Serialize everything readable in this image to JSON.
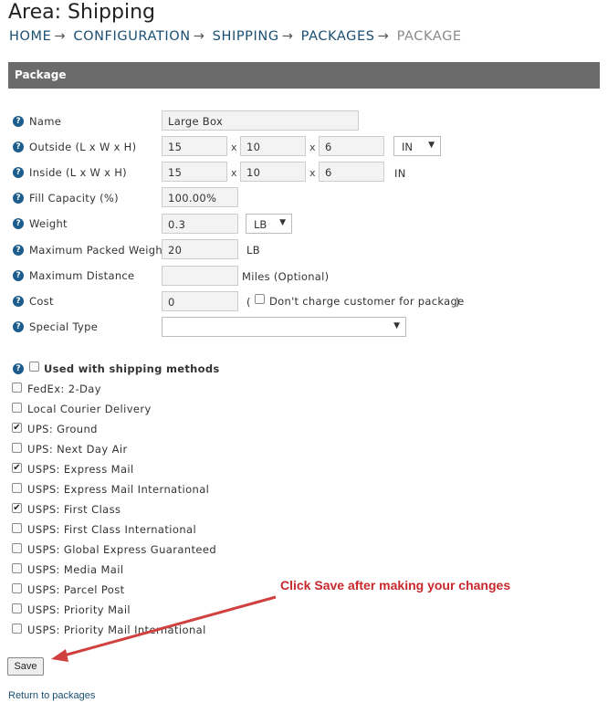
{
  "page": {
    "title": "Area: Shipping",
    "breadcrumb": [
      "HOME",
      "CONFIGURATION",
      "SHIPPING",
      "PACKAGES",
      "PACKAGE"
    ],
    "breadcrumb_sep": "→"
  },
  "panel": {
    "heading": "Package"
  },
  "form": {
    "name": {
      "label": "Name",
      "value": "Large Box"
    },
    "outside": {
      "label": "Outside (L x W x H)",
      "l": "15",
      "w": "10",
      "h": "6",
      "unit": "IN",
      "x": "x"
    },
    "inside": {
      "label": "Inside (L x W x H)",
      "l": "15",
      "w": "10",
      "h": "6",
      "unit": "IN"
    },
    "fill_capacity": {
      "label": "Fill Capacity (%)",
      "value": "100.00%"
    },
    "weight": {
      "label": "Weight",
      "value": "0.3",
      "unit": "LB"
    },
    "max_packed_weight": {
      "label": "Maximum Packed Weight",
      "value": "20",
      "unit": "LB"
    },
    "max_distance": {
      "label": "Maximum Distance",
      "value": "",
      "unit": "Miles (Optional)"
    },
    "cost": {
      "label": "Cost",
      "value": "0",
      "paren_open": "(",
      "no_charge": "Don't charge customer for package",
      "paren_close": ")"
    },
    "special_type": {
      "label": "Special Type",
      "value": ""
    }
  },
  "methods": {
    "header": "Used with shipping methods",
    "items": [
      {
        "label": "FedEx: 2-Day",
        "checked": false
      },
      {
        "label": "Local Courier Delivery",
        "checked": false
      },
      {
        "label": "UPS: Ground",
        "checked": true
      },
      {
        "label": "UPS: Next Day Air",
        "checked": false
      },
      {
        "label": "USPS: Express Mail",
        "checked": true
      },
      {
        "label": "USPS: Express Mail International",
        "checked": false
      },
      {
        "label": "USPS: First Class",
        "checked": true
      },
      {
        "label": "USPS: First Class International",
        "checked": false
      },
      {
        "label": "USPS: Global Express Guaranteed",
        "checked": false
      },
      {
        "label": "USPS: Media Mail",
        "checked": false
      },
      {
        "label": "USPS: Parcel Post",
        "checked": false
      },
      {
        "label": "USPS: Priority Mail",
        "checked": false
      },
      {
        "label": "USPS: Priority Mail International",
        "checked": false
      }
    ]
  },
  "actions": {
    "save_label": "Save",
    "return_label": "Return to packages"
  },
  "annotation": {
    "text": "Click Save after making your changes"
  },
  "icons": {
    "help": "question-circle-icon",
    "select": "caret-down-icon",
    "check": "checkmark-icon"
  },
  "colors": {
    "accent": "#1d5d8e",
    "panel": "#6b6b6b",
    "annotation": "#c8282c",
    "link": "#1a4e72"
  }
}
